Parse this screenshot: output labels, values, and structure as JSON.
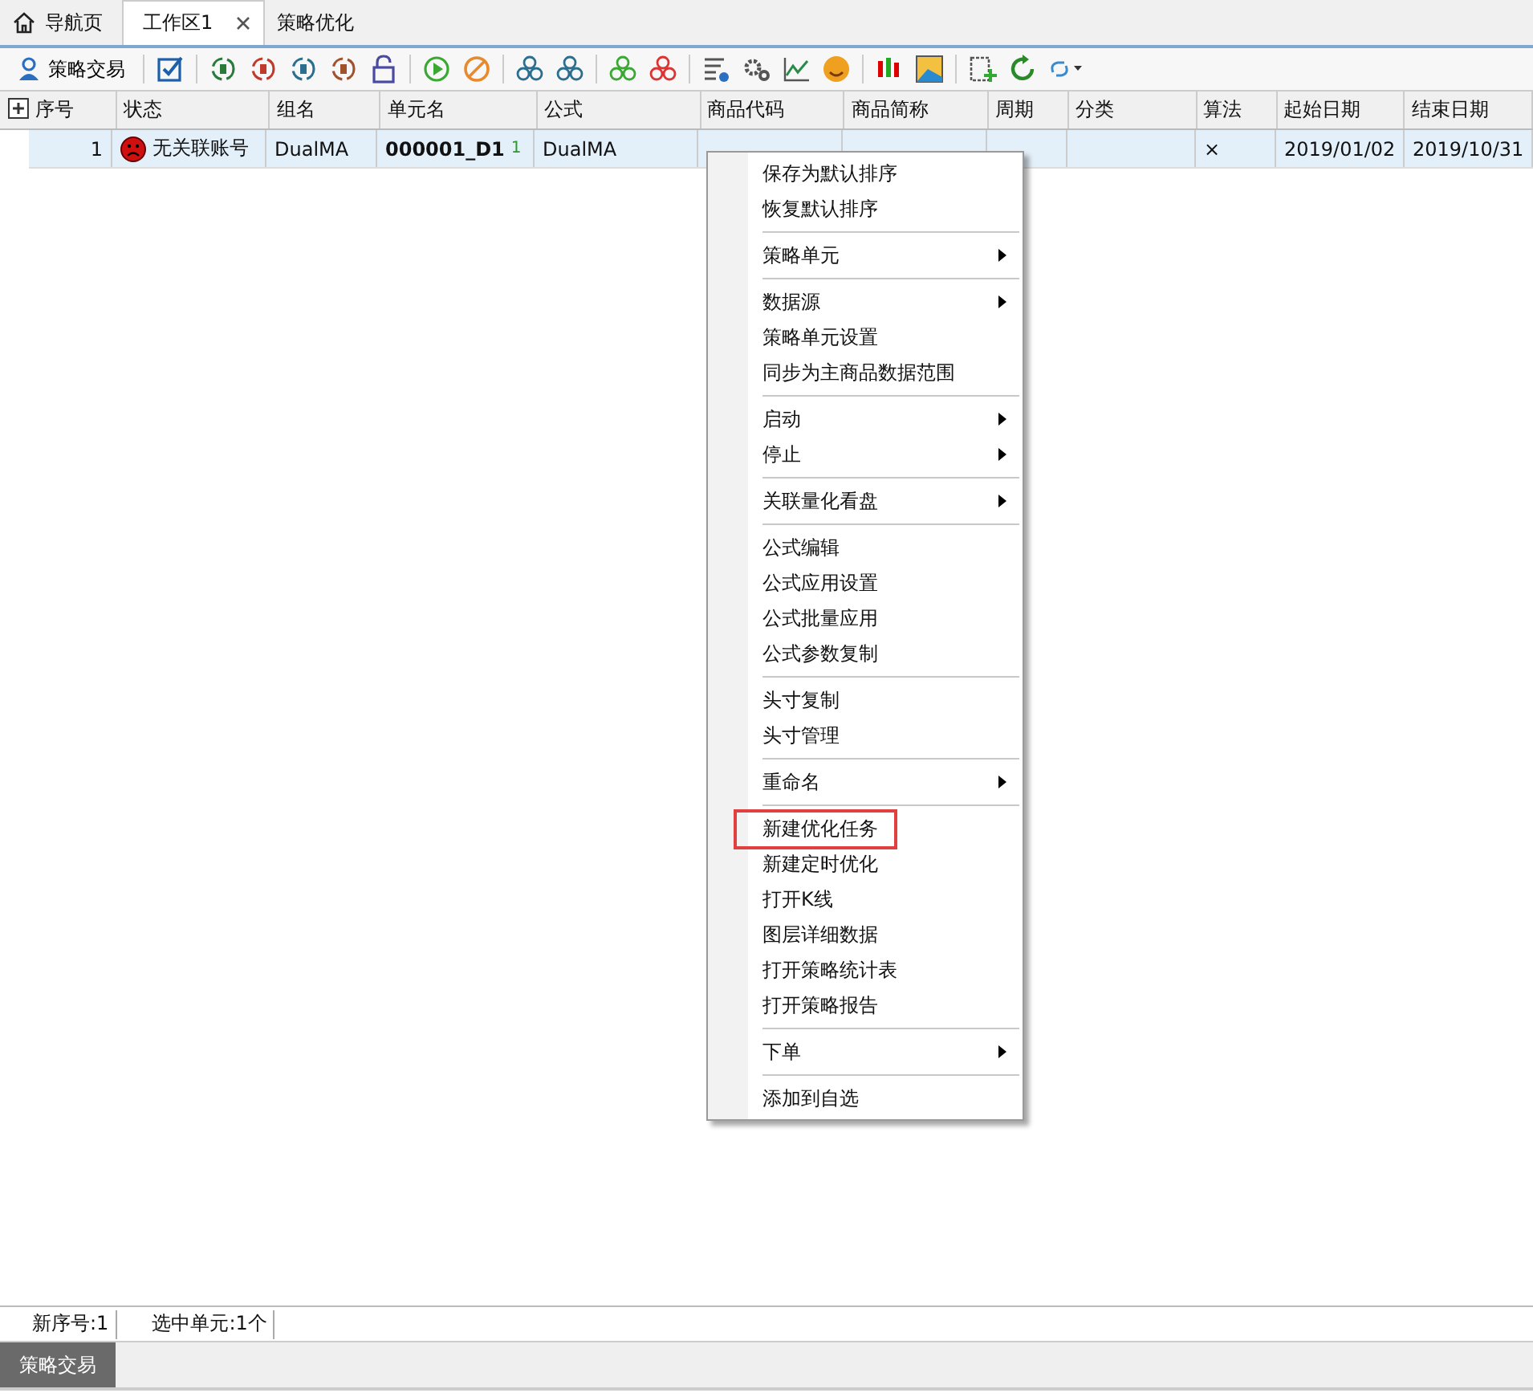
{
  "tabs": [
    {
      "label": "导航页",
      "selected": false,
      "closable": false
    },
    {
      "label": "工作区1",
      "selected": true,
      "closable": true
    },
    {
      "label": "策略优化",
      "selected": false,
      "closable": false
    }
  ],
  "toolbar": {
    "label": "策略交易"
  },
  "table": {
    "columns": [
      "序号",
      "状态",
      "组名",
      "单元名",
      "公式",
      "商品代码",
      "商品简称",
      "周期",
      "分类",
      "算法",
      "起始日期",
      "结束日期"
    ],
    "rows": [
      {
        "selected": true,
        "index": "1",
        "status": "无关联账号",
        "group": "DualMA",
        "unit": "000001_D1",
        "unit_badge": "1",
        "formula": "DualMA",
        "algo": "×",
        "start": "2019/01/02",
        "end": "2019/10/31"
      }
    ]
  },
  "context_menu": [
    {
      "kind": "item",
      "label": "保存为默认排序",
      "submenu": false,
      "highlighted": false
    },
    {
      "kind": "item",
      "label": "恢复默认排序",
      "submenu": false,
      "highlighted": false
    },
    {
      "kind": "separator"
    },
    {
      "kind": "item",
      "label": "策略单元",
      "submenu": true,
      "highlighted": false
    },
    {
      "kind": "separator"
    },
    {
      "kind": "item",
      "label": "数据源",
      "submenu": true,
      "highlighted": false
    },
    {
      "kind": "item",
      "label": "策略单元设置",
      "submenu": false,
      "highlighted": false
    },
    {
      "kind": "item",
      "label": "同步为主商品数据范围",
      "submenu": false,
      "highlighted": false
    },
    {
      "kind": "separator"
    },
    {
      "kind": "item",
      "label": "启动",
      "submenu": true,
      "highlighted": false
    },
    {
      "kind": "item",
      "label": "停止",
      "submenu": true,
      "highlighted": false
    },
    {
      "kind": "separator"
    },
    {
      "kind": "item",
      "label": "关联量化看盘",
      "submenu": true,
      "highlighted": false
    },
    {
      "kind": "separator"
    },
    {
      "kind": "item",
      "label": "公式编辑",
      "submenu": false,
      "highlighted": false
    },
    {
      "kind": "item",
      "label": "公式应用设置",
      "submenu": false,
      "highlighted": false
    },
    {
      "kind": "item",
      "label": "公式批量应用",
      "submenu": false,
      "highlighted": false
    },
    {
      "kind": "item",
      "label": "公式参数复制",
      "submenu": false,
      "highlighted": false
    },
    {
      "kind": "separator"
    },
    {
      "kind": "item",
      "label": "头寸复制",
      "submenu": false,
      "highlighted": false
    },
    {
      "kind": "item",
      "label": "头寸管理",
      "submenu": false,
      "highlighted": false
    },
    {
      "kind": "separator"
    },
    {
      "kind": "item",
      "label": "重命名",
      "submenu": true,
      "highlighted": false
    },
    {
      "kind": "separator"
    },
    {
      "kind": "item",
      "label": "新建优化任务",
      "submenu": false,
      "highlighted": true
    },
    {
      "kind": "item",
      "label": "新建定时优化",
      "submenu": false,
      "highlighted": false
    },
    {
      "kind": "item",
      "label": "打开K线",
      "submenu": false,
      "highlighted": false
    },
    {
      "kind": "item",
      "label": "图层详细数据",
      "submenu": false,
      "highlighted": false
    },
    {
      "kind": "item",
      "label": "打开策略统计表",
      "submenu": false,
      "highlighted": false
    },
    {
      "kind": "item",
      "label": "打开策略报告",
      "submenu": false,
      "highlighted": false
    },
    {
      "kind": "separator"
    },
    {
      "kind": "item",
      "label": "下单",
      "submenu": true,
      "highlighted": false
    },
    {
      "kind": "separator"
    },
    {
      "kind": "item",
      "label": "添加到自选",
      "submenu": false,
      "highlighted": false
    }
  ],
  "status_bar": [
    "新序号:1",
    "选中单元:1个"
  ],
  "bottom_tabs": [
    {
      "label": "策略交易",
      "selected": true
    }
  ]
}
